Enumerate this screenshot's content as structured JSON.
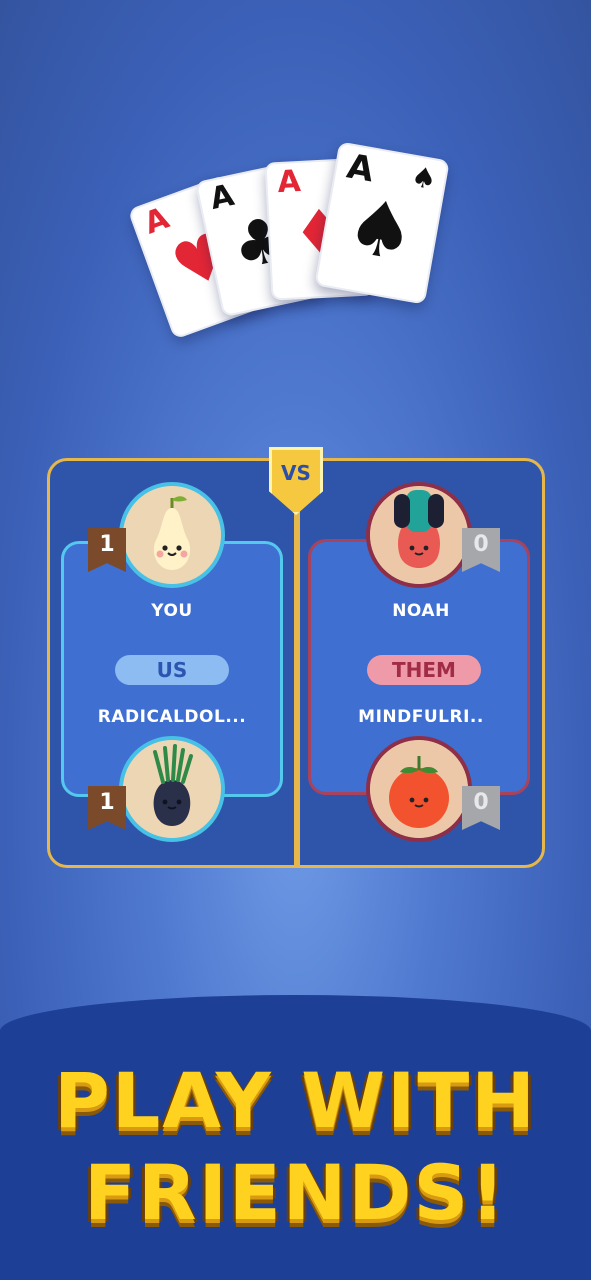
{
  "cards": [
    {
      "rank": "A",
      "suit": "♥",
      "color": "#e32636"
    },
    {
      "rank": "A",
      "suit": "♣",
      "color": "#111111"
    },
    {
      "rank": "A",
      "suit": "♦",
      "color": "#e32636"
    },
    {
      "rank": "A",
      "suit": "♠",
      "color": "#111111"
    }
  ],
  "vs_label": "VS",
  "us_team": {
    "pill": "US",
    "players": [
      {
        "name": "YOU",
        "rank_badge": "1",
        "avatar": "pear-icon"
      },
      {
        "name": "RADICALDOL...",
        "rank_badge": "1",
        "avatar": "onion-icon"
      }
    ],
    "accent": "#55c8ee"
  },
  "them_team": {
    "pill": "THEM",
    "players": [
      {
        "name": "NOAH",
        "rank_badge": "0",
        "avatar": "radish-icon"
      },
      {
        "name": "MINDFULRI..",
        "rank_badge": "0",
        "avatar": "tomato-icon"
      }
    ],
    "accent": "#a8435e"
  },
  "headline": {
    "line1": "PLAY WITH",
    "line2": "FRIENDS!"
  }
}
